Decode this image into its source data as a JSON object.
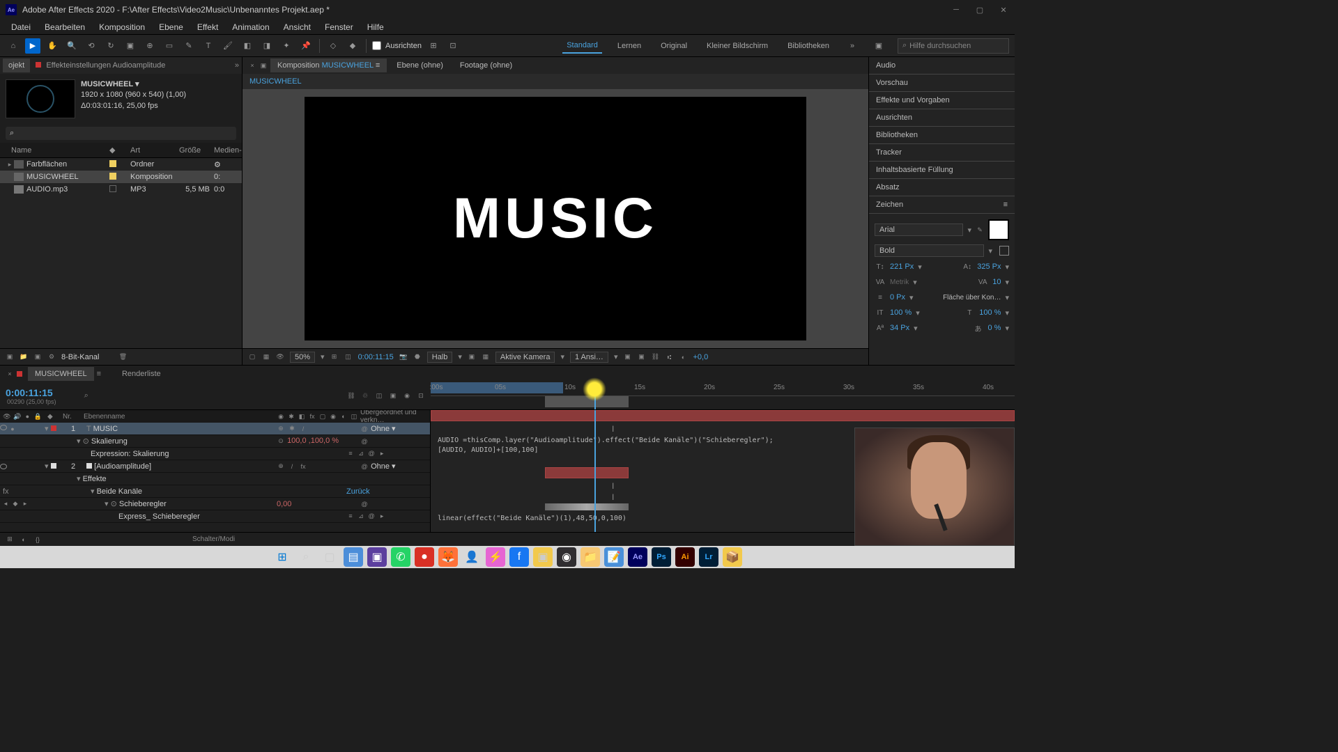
{
  "titlebar": {
    "app": "Adobe After Effects 2020",
    "path": "F:\\After Effects\\Video2Music\\Unbenanntes Projekt.aep *"
  },
  "menu": [
    "Datei",
    "Bearbeiten",
    "Komposition",
    "Ebene",
    "Effekt",
    "Animation",
    "Ansicht",
    "Fenster",
    "Hilfe"
  ],
  "toolbar": {
    "ausrichten": "Ausrichten",
    "workspaces": [
      "Standard",
      "Lernen",
      "Original",
      "Kleiner Bildschirm",
      "Bibliotheken"
    ],
    "search_placeholder": "Hilfe durchsuchen"
  },
  "left_panel": {
    "tabs": {
      "project": "ojekt",
      "effects": "Effekteinstellungen Audioamplitude"
    },
    "comp": {
      "name": "MUSICWHEEL ▾",
      "res": "1920 x 1080 (960 x 540) (1,00)",
      "dur": "Δ0:03:01:16, 25,00 fps"
    },
    "table_headers": {
      "name": "Name",
      "art": "Art",
      "size": "Größe",
      "media": "Medien-"
    },
    "rows": [
      {
        "name": "Farbflächen",
        "art": "Ordner",
        "size": "",
        "label": "yellow"
      },
      {
        "name": "MUSICWHEEL",
        "art": "Komposition",
        "size": "",
        "media": "0:",
        "label": "yellow",
        "selected": true
      },
      {
        "name": "AUDIO.mp3",
        "art": "MP3",
        "size": "5,5 MB",
        "media": "0:0",
        "label": "none"
      }
    ],
    "footer": "8-Bit-Kanal"
  },
  "center": {
    "tabs": {
      "comp": "Komposition",
      "comp_name": "MUSICWHEEL",
      "layer": "Ebene (ohne)",
      "footage": "Footage (ohne)"
    },
    "breadcrumb": "MUSICWHEEL",
    "display_text": "MUSIC",
    "footer": {
      "zoom": "50%",
      "time": "0:00:11:15",
      "res": "Halb",
      "camera": "Aktive Kamera",
      "views": "1 Ansi…",
      "exposure": "+0,0"
    }
  },
  "right_panel": {
    "sections": [
      "Audio",
      "Vorschau",
      "Effekte und Vorgaben",
      "Ausrichten",
      "Bibliotheken",
      "Tracker",
      "Inhaltsbasierte Füllung",
      "Absatz"
    ],
    "zeichen": {
      "title": "Zeichen",
      "font": "Arial",
      "weight": "Bold",
      "size": "221 Px",
      "leading": "325 Px",
      "kerning": "Metrik",
      "tracking": "10",
      "stroke": "0 Px",
      "stroke_mode": "Fläche über Kon…",
      "vscale": "100 %",
      "hscale": "100 %",
      "baseline": "34 Px",
      "tsume": "0 %"
    }
  },
  "timeline": {
    "tab": "MUSICWHEEL",
    "renderlist": "Renderliste",
    "time": "0:00:11:15",
    "subtime": "00290 (25,00 fps)",
    "ticks": [
      ":00s",
      "05s",
      "10s",
      "15s",
      "20s",
      "25s",
      "30s",
      "35s",
      "40s"
    ],
    "col_headers": {
      "nr": "Nr.",
      "ebenen": "Ebenenname",
      "parent": "Übergeordnet und verkn…"
    },
    "layers": {
      "l1": {
        "num": "1",
        "name": "MUSIC"
      },
      "l1_scale": "Skalierung",
      "l1_scale_val": "100,0 ,100,0 %",
      "l1_expr_label": "Expression: Skalierung",
      "l2": {
        "num": "2",
        "name": "[Audioamplitude]"
      },
      "l2_effects": "Effekte",
      "l2_both": "Beide Kanäle",
      "l2_reset": "Zurück",
      "l2_slider": "Schieberegler",
      "l2_slider_val": "0,00",
      "l2_expr_label": "Express_ Schieberegler",
      "parent_none": "Ohne"
    },
    "expressions": {
      "expr1": "AUDIO =thisComp.layer(\"Audioamplitude\").effect(\"Beide Kanäle\")(\"Schieberegler\");",
      "expr1b": "[AUDIO, AUDIO]+[100,100]",
      "expr2": "linear(effect(\"Beide Kanäle\")(1),48,50,0,100)"
    },
    "footer": "Schalter/Modi"
  }
}
